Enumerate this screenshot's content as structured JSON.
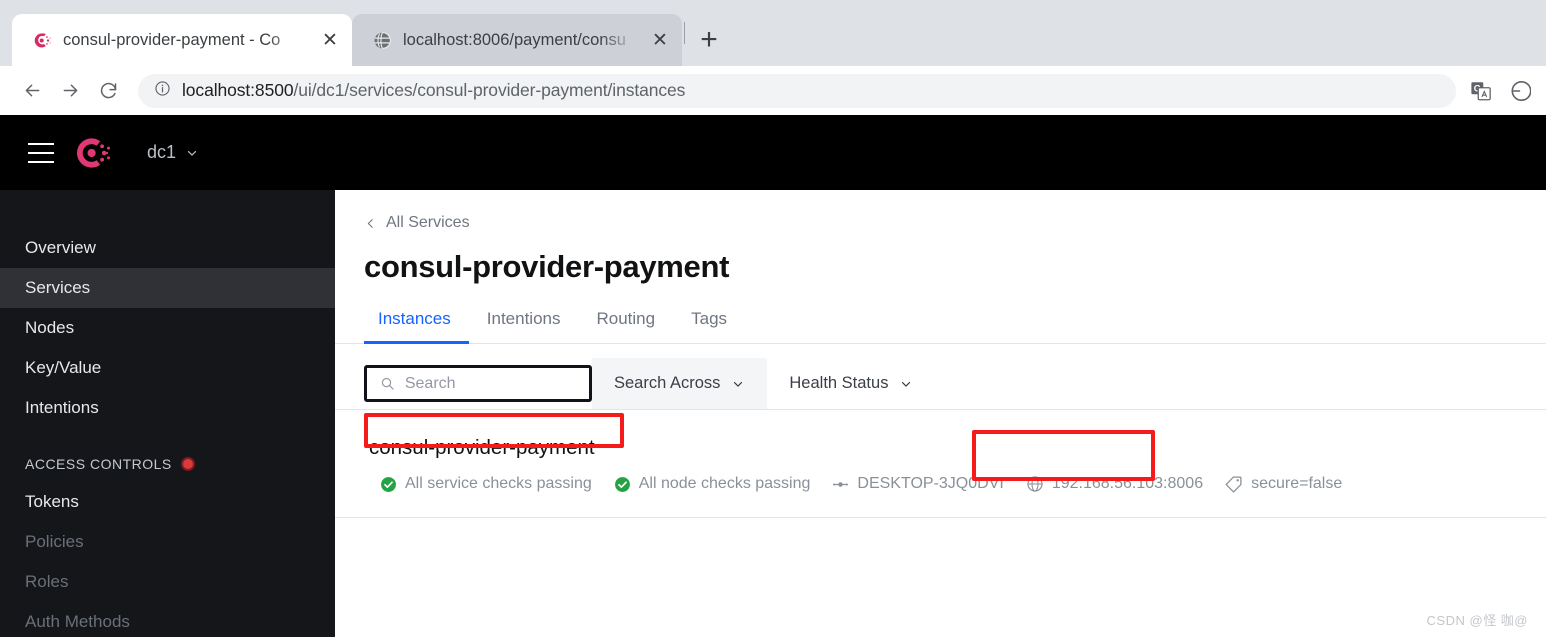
{
  "browser": {
    "tabs": [
      {
        "title": "consul-provider-payment - Co",
        "favicon": "consul-icon",
        "active": true,
        "close_label": "✕"
      },
      {
        "title": "localhost:8006/payment/consu",
        "favicon": "globe-icon",
        "active": false,
        "close_label": "✕"
      }
    ],
    "new_tab_label": "+",
    "back_label": "←",
    "forward_label": "→",
    "reload_label": "↻",
    "url_host": "localhost:8500",
    "url_path": "/ui/dc1/services/consul-provider-payment/instances",
    "url_full": "localhost:8500/ui/dc1/services/consul-provider-payment/instances",
    "site_info_icon": "info-circle-icon",
    "toolbar_icons": [
      "translate-icon",
      "profile-circle-icon"
    ]
  },
  "consul": {
    "header": {
      "menu_icon": "hamburger-menu-icon",
      "logo": "consul-logo",
      "datacenter": "dc1",
      "datacenter_chevron": "chevron-down-icon"
    },
    "sidebar": {
      "items": [
        {
          "label": "Overview",
          "state": "normal"
        },
        {
          "label": "Services",
          "state": "active"
        },
        {
          "label": "Nodes",
          "state": "normal"
        },
        {
          "label": "Key/Value",
          "state": "normal"
        },
        {
          "label": "Intentions",
          "state": "normal"
        }
      ],
      "section_label": "ACCESS CONTROLS",
      "section_badge": "red-dot",
      "acl_items": [
        {
          "label": "Tokens",
          "state": "normal"
        },
        {
          "label": "Policies",
          "state": "dim"
        },
        {
          "label": "Roles",
          "state": "dim"
        },
        {
          "label": "Auth Methods",
          "state": "dim"
        }
      ]
    },
    "main": {
      "breadcrumb": "All Services",
      "breadcrumb_icon": "chevron-left-icon",
      "title": "consul-provider-payment",
      "tabs": [
        {
          "label": "Instances",
          "active": true
        },
        {
          "label": "Intentions",
          "active": false
        },
        {
          "label": "Routing",
          "active": false
        },
        {
          "label": "Tags",
          "active": false
        }
      ],
      "filters": {
        "search_placeholder": "Search",
        "search_value": "",
        "search_icon": "search-icon",
        "search_across_label": "Search Across",
        "health_status_label": "Health Status"
      },
      "instances": [
        {
          "name": "consul-provider-payment",
          "service_check": "All service checks passing",
          "service_check_icon": "check-circle-icon",
          "node_check": "All node checks passing",
          "node_check_icon": "check-circle-icon",
          "node_name": "DESKTOP-3JQ0DVI",
          "node_icon": "node-icon",
          "address": "192.168.56.103:8006",
          "address_icon": "globe-icon",
          "tag": "secure=false",
          "tag_icon": "tag-icon"
        }
      ]
    }
  },
  "colors": {
    "accent_blue": "#1563ff",
    "consul_pink": "#e03875",
    "health_green": "#23a344",
    "annotation_red": "#f61a1a",
    "sidebar_bg": "#14161a",
    "header_bg": "#000000"
  },
  "watermark": "CSDN @怪 咖@"
}
